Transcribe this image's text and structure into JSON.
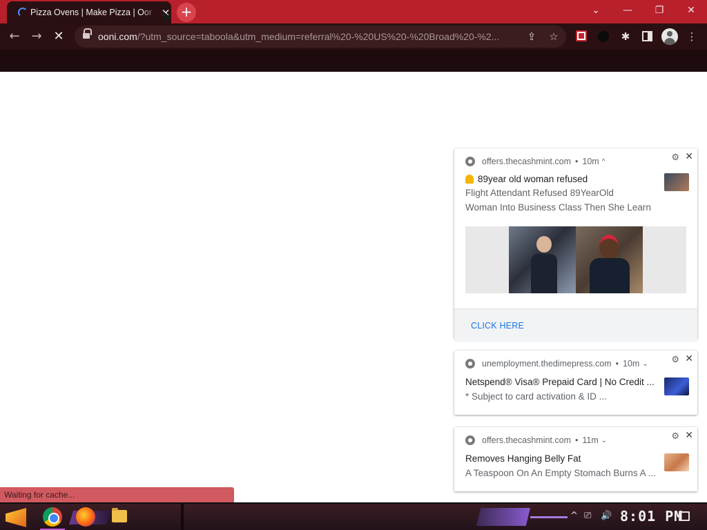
{
  "browser": {
    "tab_title": "Pizza Ovens | Make Pizza | Ooni",
    "tab_close_glyph": "✕",
    "new_tab_glyph": "+",
    "window_controls": {
      "tabsearch": "⌄",
      "minimize": "—",
      "restore": "❐",
      "close": "✕"
    },
    "nav": {
      "back": "←",
      "forward": "→",
      "stop": "✕"
    },
    "url_host": "ooni.com",
    "url_path": "/?utm_source=taboola&utm_medium=referral%20-%20US%20-%20Broad%20-%2...",
    "share_glyph": "⇪",
    "star_glyph": "☆",
    "puzzle_glyph": "✱",
    "menu_glyph": "⋮"
  },
  "status_bar": {
    "text": "Waiting for cache..."
  },
  "notifications": [
    {
      "source": "offers.thecashmint.com",
      "age": "10m",
      "chevron": "^",
      "title": "89year old woman refused",
      "body_line1": "Flight Attendant Refused 89YearOld",
      "body_line2": "Woman Into Business Class  Then She Learn",
      "action": "CLICK HERE"
    },
    {
      "source": "unemployment.thedimepress.com",
      "age": "10m",
      "chevron": "⌄",
      "title": "Netspend® Visa® Prepaid Card | No Credit ...",
      "body": "* Subject to card activation & ID ..."
    },
    {
      "source": "offers.thecashmint.com",
      "age": "11m",
      "chevron": "⌄",
      "title": "Removes Hanging Belly Fat",
      "body": "A Teaspoon On An Empty Stomach Burns A ..."
    }
  ],
  "notification_controls": {
    "dot": "•",
    "gear": "⚙",
    "close": "✕"
  },
  "taskbar": {
    "clock": "8:01 PM",
    "tray_up": "^",
    "tray_network": "⎚",
    "tray_volume": "🔊"
  },
  "colors": {
    "tabstrip": "#b8202c",
    "toolbar": "#2a1013",
    "action_link": "#1a73e8",
    "status_bg": "#d05a60"
  }
}
